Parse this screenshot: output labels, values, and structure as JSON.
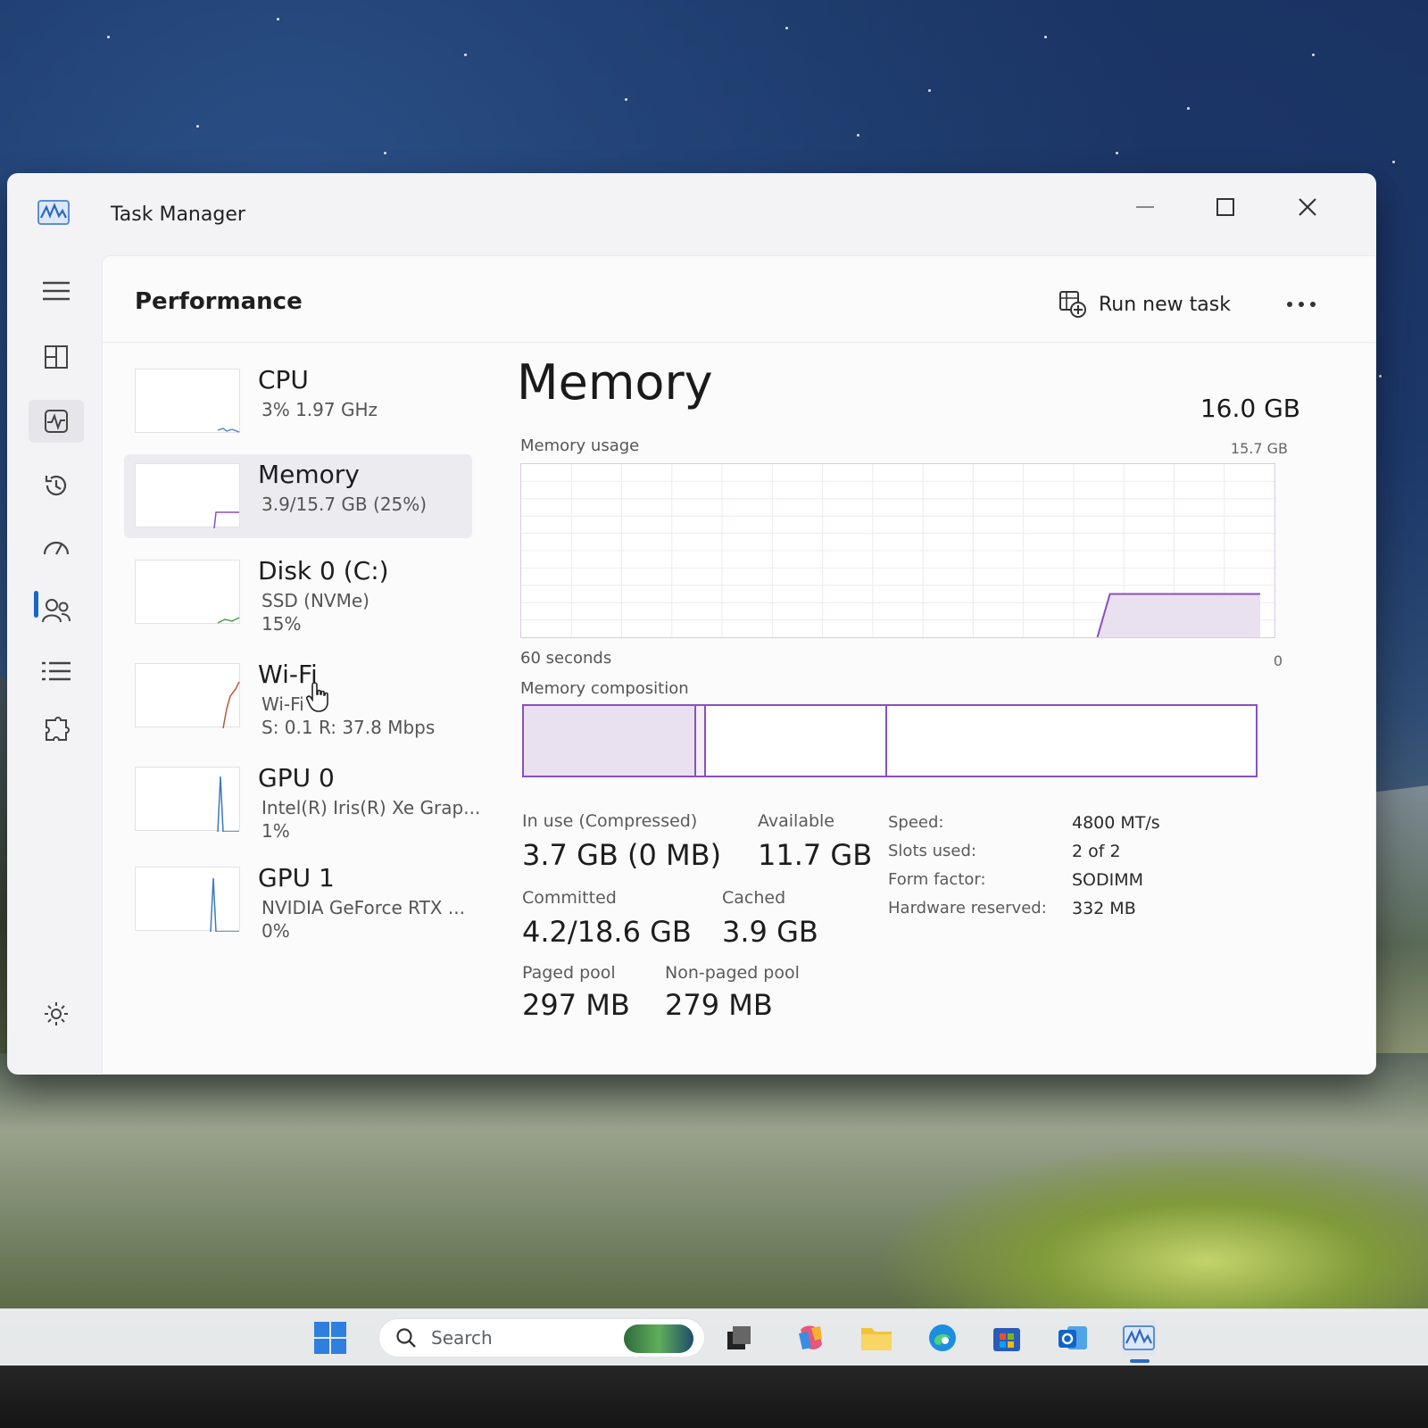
{
  "window": {
    "title": "Task Manager"
  },
  "header": {
    "page_title": "Performance",
    "run_new_task": "Run new task"
  },
  "devices": [
    {
      "name": "CPU",
      "line1": "3%  1.97 GHz",
      "line2": ""
    },
    {
      "name": "Memory",
      "line1": "3.9/15.7 GB (25%)",
      "line2": ""
    },
    {
      "name": "Disk 0 (C:)",
      "line1": "SSD (NVMe)",
      "line2": "15%"
    },
    {
      "name": "Wi-Fi",
      "line1": "Wi-Fi",
      "line2": "S: 0.1  R: 37.8 Mbps"
    },
    {
      "name": "GPU 0",
      "line1": "Intel(R) Iris(R) Xe Grap...",
      "line2": "1%"
    },
    {
      "name": "GPU 1",
      "line1": "NVIDIA GeForce RTX ...",
      "line2": "0%"
    }
  ],
  "memory": {
    "title": "Memory",
    "total": "16.0 GB",
    "usage_label": "Memory usage",
    "usage_max": "15.7 GB",
    "axis_left": "60 seconds",
    "axis_right": "0",
    "composition_label": "Memory composition",
    "in_use_label": "In use (Compressed)",
    "in_use_value": "3.7 GB (0 MB)",
    "available_label": "Available",
    "available_value": "11.7 GB",
    "committed_label": "Committed",
    "committed_value": "4.2/18.6 GB",
    "cached_label": "Cached",
    "cached_value": "3.9 GB",
    "paged_label": "Paged pool",
    "paged_value": "297 MB",
    "nonpaged_label": "Non-paged pool",
    "nonpaged_value": "279 MB",
    "specs": [
      {
        "label": "Speed:",
        "value": "4800 MT/s"
      },
      {
        "label": "Slots used:",
        "value": "2 of 2"
      },
      {
        "label": "Form factor:",
        "value": "SODIMM"
      },
      {
        "label": "Hardware reserved:",
        "value": "332 MB"
      }
    ],
    "usage_history_percent": [
      0,
      0,
      0,
      0,
      0,
      0,
      0,
      0,
      0,
      0,
      0,
      0,
      0,
      0,
      0,
      0,
      0,
      0,
      0,
      0,
      0,
      0,
      0,
      0,
      0,
      0,
      0,
      0,
      0,
      0,
      0,
      0,
      0,
      0,
      0,
      0,
      0,
      0,
      0,
      0,
      0,
      0,
      0,
      0,
      0,
      0,
      0,
      25,
      25,
      25,
      25,
      25,
      25,
      25,
      25,
      25,
      25,
      25,
      25,
      25
    ],
    "composition": {
      "in_use_gb": 3.7,
      "modified_gb": 0.2,
      "standby_gb": 3.9,
      "free_gb": 7.9
    }
  },
  "taskbar": {
    "search_placeholder": "Search"
  },
  "colors": {
    "memory_accent": "#8a4fbf",
    "memory_fill": "#e9e0f0",
    "nav_indicator": "#1a64c8"
  }
}
